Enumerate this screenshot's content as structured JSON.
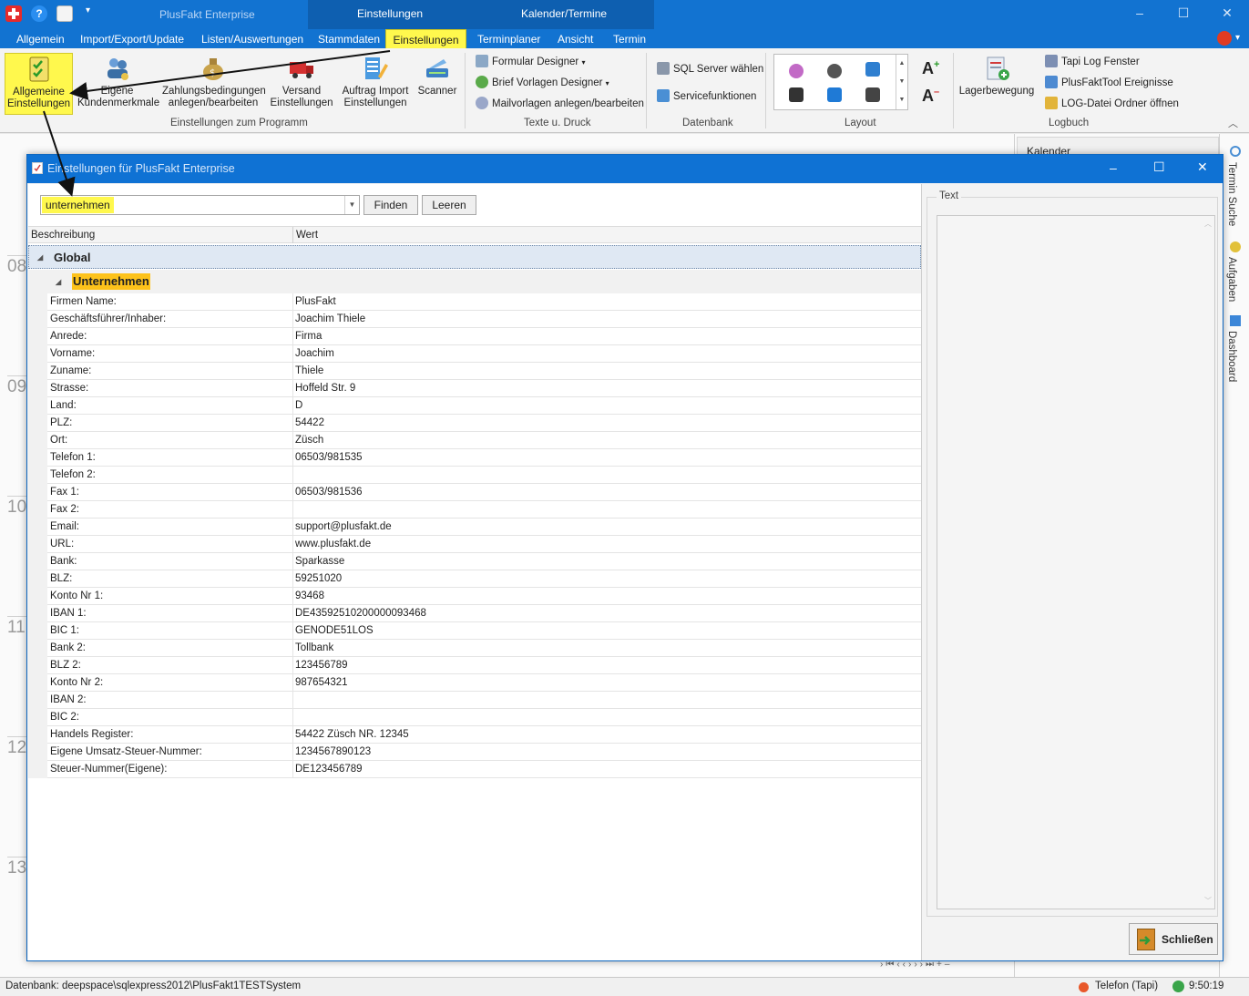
{
  "app": {
    "title": "PlusFakt Enterprise",
    "context_tabs": [
      "Einstellungen",
      "Kalender/Termine"
    ]
  },
  "tabs": [
    {
      "label": "Allgemein"
    },
    {
      "label": "Import/Export/Update"
    },
    {
      "label": "Listen/Auswertungen"
    },
    {
      "label": "Stammdaten"
    },
    {
      "label": "Einstellungen",
      "active": true
    },
    {
      "label": "Terminplaner"
    },
    {
      "label": "Ansicht"
    },
    {
      "label": "Termin"
    }
  ],
  "ribbon": {
    "group_programm": {
      "label": "Einstellungen zum Programm",
      "buttons": [
        {
          "label": "Allgemeine Einstellungen",
          "icon": "checklist-icon",
          "active": true
        },
        {
          "label": "Eigene Kundenmerkmale",
          "icon": "users-icon"
        },
        {
          "label": "Zahlungsbedingungen anlegen/bearbeiten",
          "icon": "money-bag-icon"
        },
        {
          "label": "Versand Einstellungen",
          "icon": "truck-icon"
        },
        {
          "label": "Auftrag Import Einstellungen",
          "icon": "import-pencil-icon"
        },
        {
          "label": "Scanner",
          "icon": "scanner-icon"
        }
      ]
    },
    "group_texte": {
      "label": "Texte u. Druck",
      "items": [
        "Formular Designer",
        "Brief Vorlagen Designer",
        "Mailvorlagen anlegen/bearbeiten"
      ]
    },
    "group_datenbank": {
      "label": "Datenbank",
      "items": [
        "SQL Server wählen",
        "Servicefunktionen"
      ]
    },
    "group_layout": {
      "label": "Layout"
    },
    "group_logbuch": {
      "label": "Logbuch",
      "lagerbewegung": "Lagerbewegung",
      "items": [
        "Tapi Log Fenster",
        "PlusFaktTool Ereignisse",
        "LOG-Datei Ordner öffnen"
      ]
    }
  },
  "background": {
    "hours": [
      "08",
      "09",
      "10",
      "11",
      "12",
      "13"
    ],
    "kalender": "Kalender",
    "side_tabs": [
      "Termin Suche",
      "Aufgaben",
      "Dashboard"
    ]
  },
  "dialog": {
    "title": "Einstellungen für PlusFakt Enterprise",
    "search_value": "unternehmen",
    "find_label": "Finden",
    "clear_label": "Leeren",
    "col_desc": "Beschreibung",
    "col_value": "Wert",
    "category": "Global",
    "subcategory": "Unternehmen",
    "rows": [
      {
        "desc": "Firmen Name:",
        "value": "PlusFakt"
      },
      {
        "desc": "Geschäftsführer/Inhaber:",
        "value": "Joachim Thiele"
      },
      {
        "desc": "Anrede:",
        "value": "Firma"
      },
      {
        "desc": "Vorname:",
        "value": "Joachim"
      },
      {
        "desc": "Zuname:",
        "value": "Thiele"
      },
      {
        "desc": "Strasse:",
        "value": "Hoffeld Str. 9"
      },
      {
        "desc": "Land:",
        "value": "D"
      },
      {
        "desc": "PLZ:",
        "value": "54422"
      },
      {
        "desc": "Ort:",
        "value": "Züsch"
      },
      {
        "desc": "Telefon 1:",
        "value": "06503/981535"
      },
      {
        "desc": "Telefon 2:",
        "value": ""
      },
      {
        "desc": "Fax 1:",
        "value": "06503/981536"
      },
      {
        "desc": "Fax 2:",
        "value": ""
      },
      {
        "desc": "Email:",
        "value": "support@plusfakt.de"
      },
      {
        "desc": "URL:",
        "value": "www.plusfakt.de"
      },
      {
        "desc": "Bank:",
        "value": "Sparkasse"
      },
      {
        "desc": "BLZ:",
        "value": "59251020"
      },
      {
        "desc": "Konto Nr 1:",
        "value": "93468"
      },
      {
        "desc": "IBAN 1:",
        "value": "DE43592510200000093468"
      },
      {
        "desc": "BIC 1:",
        "value": "GENODE51LOS"
      },
      {
        "desc": "Bank 2:",
        "value": "Tollbank"
      },
      {
        "desc": "BLZ 2:",
        "value": "123456789"
      },
      {
        "desc": "Konto Nr 2:",
        "value": "987654321"
      },
      {
        "desc": "IBAN 2:",
        "value": ""
      },
      {
        "desc": "BIC 2:",
        "value": ""
      },
      {
        "desc": "Handels Register:",
        "value": "54422 Züsch NR. 12345"
      },
      {
        "desc": "Eigene Umsatz-Steuer-Nummer:",
        "value": "1234567890123"
      },
      {
        "desc": "Steuer-Nummer(Eigene):",
        "value": "DE123456789"
      }
    ],
    "text_label": "Text",
    "close_label": "Schließen"
  },
  "status": {
    "database": "Datenbank: deepspace\\sqlexpress2012\\PlusFakt1TESTSystem",
    "telefon": "Telefon (Tapi)",
    "time": "9:50:19"
  },
  "colors": {
    "titlebar": "#1273d1",
    "highlight": "#fff84d",
    "subcategory_highlight": "#fdc21a"
  }
}
